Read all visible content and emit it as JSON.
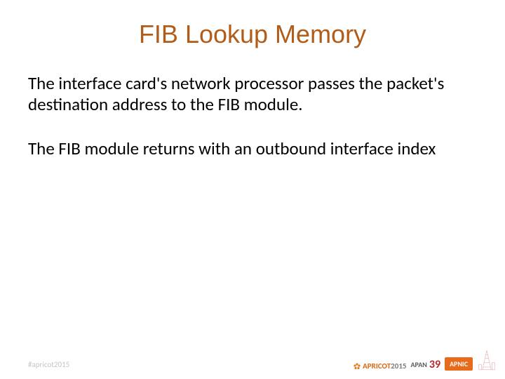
{
  "slide": {
    "title": "FIB Lookup Memory",
    "paragraph1": "The interface card's network processor passes the packet's destination address to the FIB module.",
    "paragraph2": "The FIB module returns with an outbound interface index"
  },
  "footer": {
    "hashtag": "#apricot2015",
    "apricot_label": "APRICOT",
    "apricot_year": "2015",
    "apan_label": "APAN",
    "apan_num": "39",
    "apnic_label": "APNIC"
  },
  "colors": {
    "title": "#b25c1a",
    "body": "#000000",
    "hashtag_grey": "#c8c4c0",
    "apricot_orange": "#d96a12",
    "apan_red": "#ba2a2a",
    "apnic_bg": "#e86b1c"
  }
}
